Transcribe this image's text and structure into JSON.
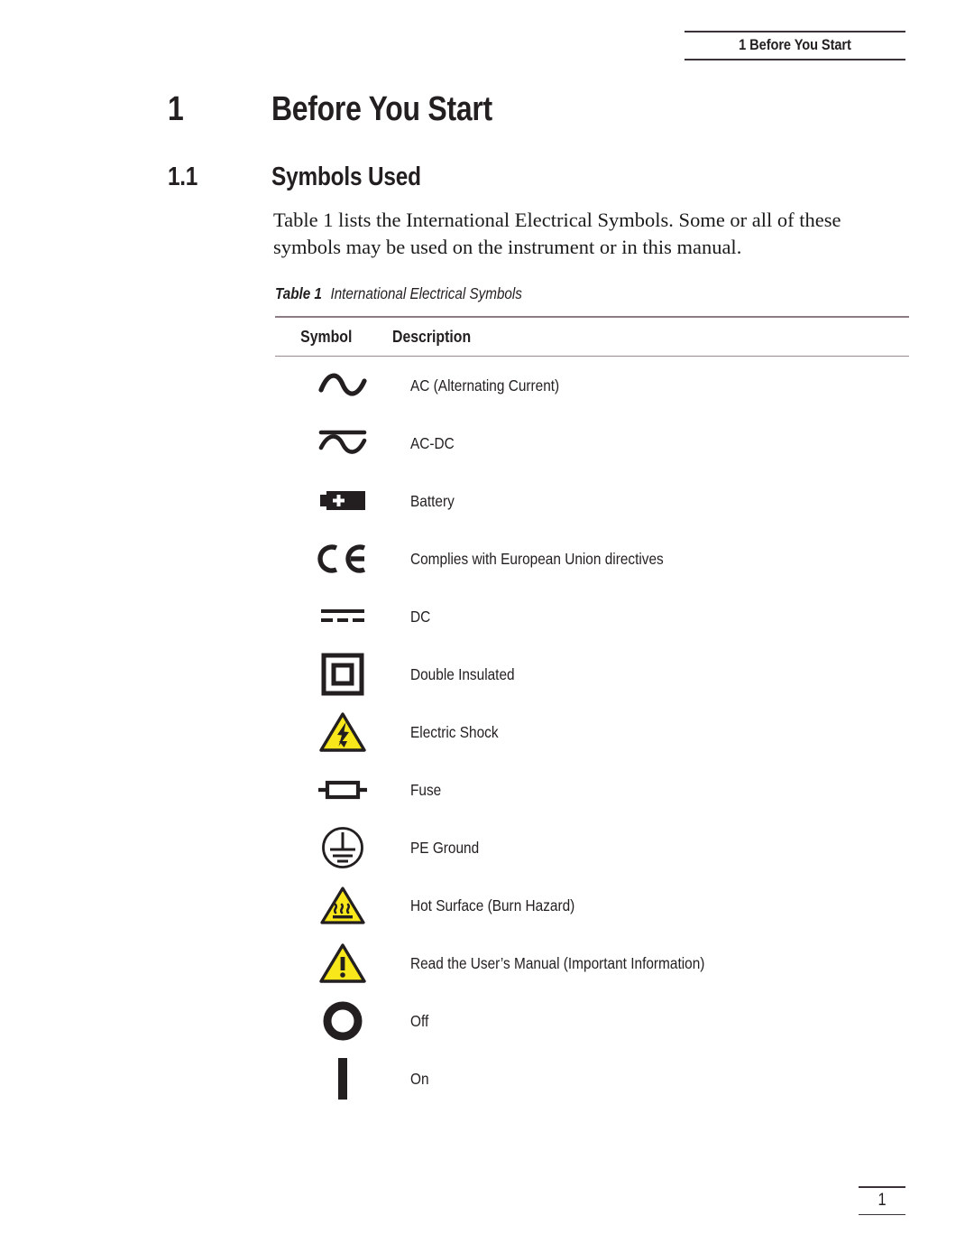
{
  "header": {
    "running_head": "1 Before You Start"
  },
  "chapter": {
    "number": "1",
    "title": "Before You Start"
  },
  "section": {
    "number": "1.1",
    "title": "Symbols Used"
  },
  "body": {
    "paragraph": "Table 1 lists the International Electrical Symbols. Some or all of these symbols may be used on the instrument or in this manual."
  },
  "table": {
    "caption_label": "Table 1",
    "caption_text": "International Electrical Symbols",
    "columns": [
      "Symbol",
      "Description"
    ],
    "rows": [
      {
        "icon": "ac-sine-icon",
        "description": "AC (Alternating Current)"
      },
      {
        "icon": "ac-dc-icon",
        "description": "AC-DC"
      },
      {
        "icon": "battery-icon",
        "description": "Battery"
      },
      {
        "icon": "ce-mark-icon",
        "description": "Complies with European Union directives"
      },
      {
        "icon": "dc-icon",
        "description": "DC"
      },
      {
        "icon": "double-insulated-icon",
        "description": "Double Insulated"
      },
      {
        "icon": "electric-shock-icon",
        "description": "Electric Shock"
      },
      {
        "icon": "fuse-icon",
        "description": "Fuse"
      },
      {
        "icon": "pe-ground-icon",
        "description": "PE Ground"
      },
      {
        "icon": "hot-surface-icon",
        "description": "Hot Surface (Burn Hazard)"
      },
      {
        "icon": "warning-manual-icon",
        "description": "Read the User’s Manual (Important Information)"
      },
      {
        "icon": "power-off-icon",
        "description": "Off"
      },
      {
        "icon": "power-on-icon",
        "description": "On"
      }
    ]
  },
  "footer": {
    "page_number": "1"
  },
  "colors": {
    "ink": "#231f20",
    "rule": "#9b8a91",
    "hazard_yellow": "#f7e71b"
  }
}
